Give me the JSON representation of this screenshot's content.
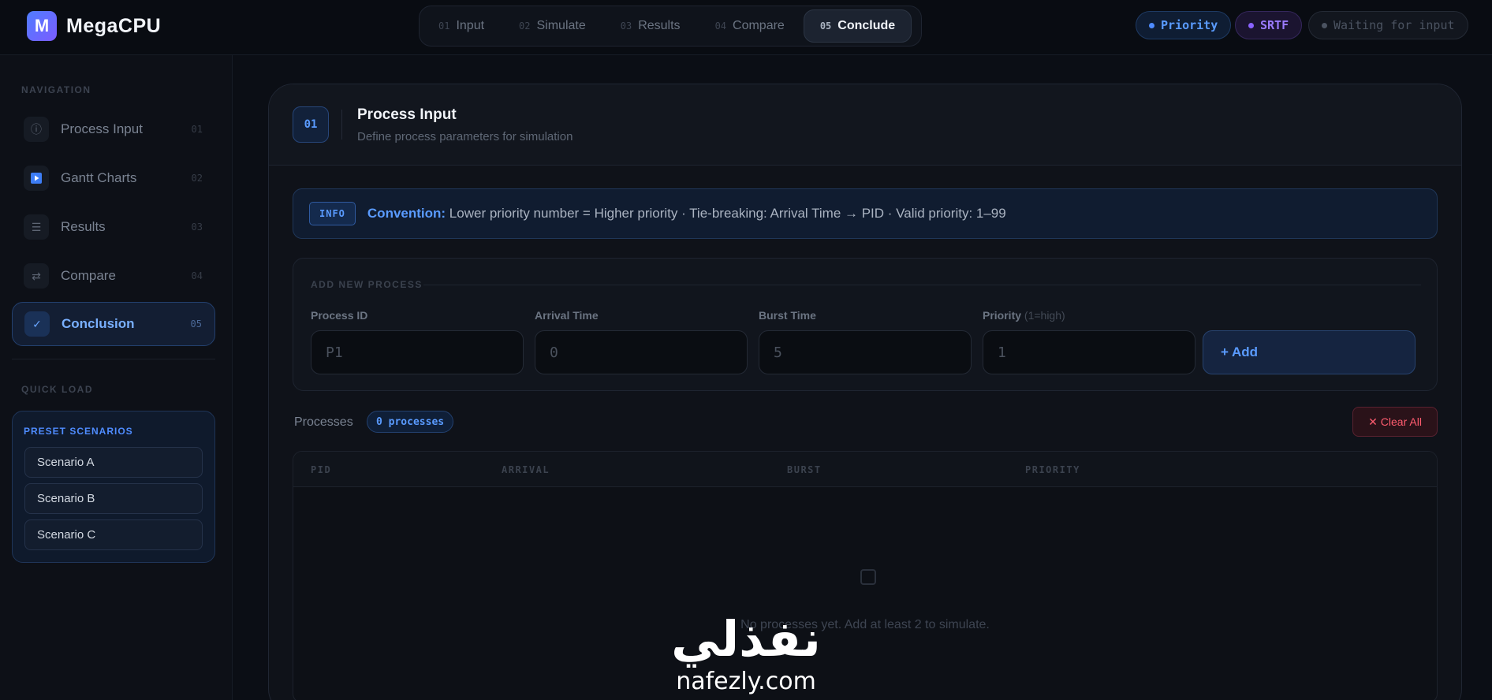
{
  "brand": {
    "logo_letter": "M",
    "name": "MegaCPU",
    "logo_gradient": [
      "#4f7dff",
      "#7b5cff"
    ]
  },
  "steps": [
    {
      "num": "01",
      "label": "Input"
    },
    {
      "num": "02",
      "label": "Simulate"
    },
    {
      "num": "03",
      "label": "Results"
    },
    {
      "num": "04",
      "label": "Compare"
    },
    {
      "num": "05",
      "label": "Conclude",
      "active": true
    }
  ],
  "status_pills": {
    "priority": "Priority",
    "srtf": "SRTF",
    "status": "Waiting for input"
  },
  "sidebar": {
    "navigation_heading": "NAVIGATION",
    "items": [
      {
        "label": "Process Input",
        "num": "01",
        "icon": "info-icon"
      },
      {
        "label": "Gantt Charts",
        "num": "02",
        "icon": "play-icon"
      },
      {
        "label": "Results",
        "num": "03",
        "icon": "list-icon"
      },
      {
        "label": "Compare",
        "num": "04",
        "icon": "swap-icon"
      },
      {
        "label": "Conclusion",
        "num": "05",
        "icon": "check-icon",
        "active": true
      }
    ],
    "quick_load_heading": "QUICK LOAD",
    "preset_title": "PRESET SCENARIOS",
    "presets": [
      "Scenario A",
      "Scenario B",
      "Scenario C"
    ]
  },
  "main": {
    "badge": "01",
    "title": "Process Input",
    "subtitle": "Define process parameters for simulation",
    "info": {
      "tag": "INFO",
      "label": "Convention:",
      "text": "Lower priority number = Higher priority  ·  Tie-breaking: Arrival Time → PID  ·  Valid priority: 1–99"
    },
    "add_process": {
      "heading": "ADD NEW PROCESS",
      "fields": [
        {
          "label": "Process ID",
          "hint": "",
          "placeholder": "P1"
        },
        {
          "label": "Arrival Time",
          "hint": "",
          "placeholder": "0"
        },
        {
          "label": "Burst Time",
          "hint": "",
          "placeholder": "5"
        },
        {
          "label": "Priority",
          "hint": "(1=high)",
          "placeholder": "1"
        }
      ],
      "add_label": "+ Add"
    },
    "processes_label": "Processes",
    "processes_count": "0 processes",
    "clear_label": "Clear All",
    "table_columns": [
      "PID",
      "ARRIVAL",
      "BURST",
      "PRIORITY"
    ],
    "empty_text": "No processes yet. Add at least 2 to simulate."
  },
  "watermark": {
    "arabic": "نفذلي",
    "latin": "nafezly.com"
  },
  "colors": {
    "accent": "#5a9bff",
    "srtf": "#9b7bff",
    "danger": "#ff5c6f",
    "background": "#0b0e15"
  }
}
